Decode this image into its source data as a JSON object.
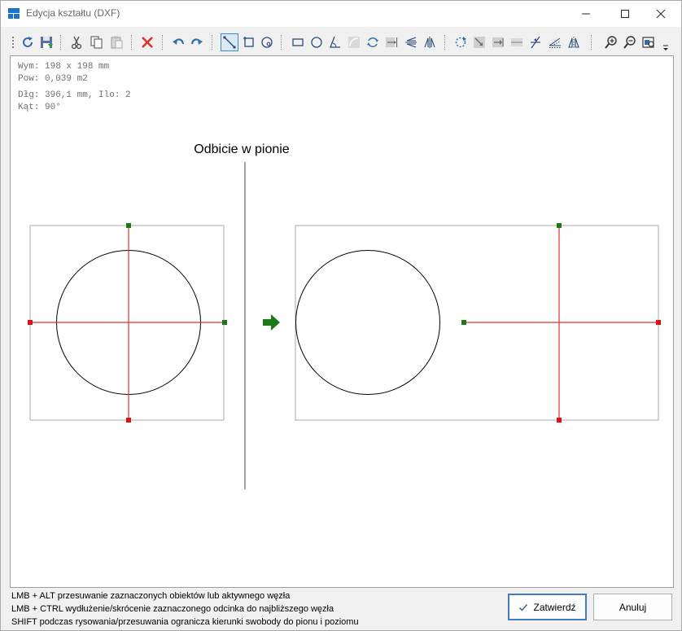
{
  "window": {
    "title": "Edycja kształtu (DXF)"
  },
  "toolbar": {
    "buttons": [
      {
        "name": "refresh-icon",
        "active": false
      },
      {
        "name": "save-icon",
        "active": false
      },
      {
        "name": "cut-icon",
        "active": false
      },
      {
        "name": "copy-icon",
        "active": false
      },
      {
        "name": "paste-icon",
        "active": false
      },
      {
        "name": "delete-icon",
        "active": false
      },
      {
        "name": "undo-icon",
        "active": false
      },
      {
        "name": "redo-icon",
        "active": false
      },
      {
        "name": "select-line-icon",
        "active": true
      },
      {
        "name": "select-rect-icon",
        "active": false
      },
      {
        "name": "select-circle-icon",
        "active": false
      },
      {
        "name": "draw-rect-icon",
        "active": false
      },
      {
        "name": "draw-circle-icon",
        "active": false
      },
      {
        "name": "draw-angle-icon",
        "active": false
      },
      {
        "name": "draw-arc-icon",
        "active": false
      },
      {
        "name": "rotate-icon",
        "active": false
      },
      {
        "name": "extend-icon",
        "active": false
      },
      {
        "name": "mirror-h-icon",
        "active": false
      },
      {
        "name": "mirror-v-icon",
        "active": false
      },
      {
        "name": "rotate-dotted-icon",
        "active": false
      },
      {
        "name": "scale-icon",
        "active": false
      },
      {
        "name": "stretch-icon",
        "active": false
      },
      {
        "name": "trim-icon",
        "active": false
      },
      {
        "name": "intersect-icon",
        "active": false
      },
      {
        "name": "offset-icon",
        "active": false
      },
      {
        "name": "mirror-icon",
        "active": false
      },
      {
        "name": "zoom-in-icon",
        "active": false
      },
      {
        "name": "zoom-out-icon",
        "active": false
      },
      {
        "name": "zoom-fit-icon",
        "active": false
      },
      {
        "name": "overflow-menu-icon",
        "active": false
      }
    ]
  },
  "info": {
    "line1": "Wym: 198 x 198 mm",
    "line2": "Pow: 0,039 m2",
    "line3": "Dłg: 396,1 mm, Ilo: 2",
    "line4": "Kąt: 90°"
  },
  "canvas": {
    "caption": "Odbicie w pionie",
    "colors": {
      "line": "#e03030",
      "node_active": "#1a7a1a",
      "node_inactive": "#e01010",
      "arrow": "#1a7a1a",
      "bbox": "#a8a8a8",
      "circle": "#000000"
    }
  },
  "status": {
    "hint1": "LMB + ALT przesuwanie zaznaczonych obiektów lub aktywnego węzła",
    "hint2": "LMB + CTRL wydłużenie/skrócenie zaznaczonego odcinka do najbliższego węzła",
    "hint3": "SHIFT podczas rysowania/przesuwania ogranicza kierunki swobody do pionu i poziomu"
  },
  "buttons": {
    "confirm": "Zatwierdź",
    "cancel": "Anuluj"
  }
}
